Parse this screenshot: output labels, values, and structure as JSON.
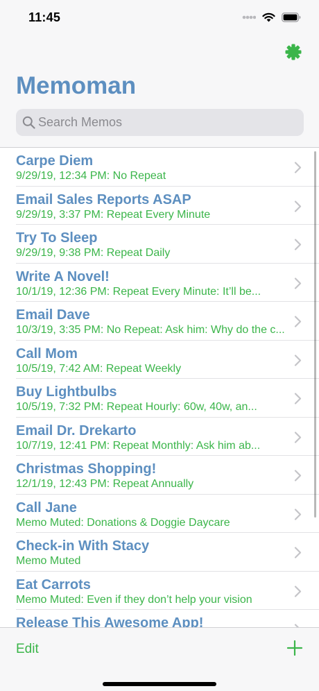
{
  "status_bar": {
    "time": "11:45"
  },
  "header": {
    "title": "Memoman"
  },
  "search": {
    "placeholder": "Search Memos",
    "value": ""
  },
  "colors": {
    "title_blue": "#5d8fc0",
    "accent_green": "#3bb54a"
  },
  "icons": {
    "settings": "gear-icon",
    "search": "search-icon",
    "row_disclosure": "chevron-right-icon",
    "add": "plus-icon"
  },
  "memos": [
    {
      "title": "Carpe Diem",
      "subtitle": "9/29/19, 12:34 PM: No Repeat"
    },
    {
      "title": "Email Sales Reports ASAP",
      "subtitle": "9/29/19, 3:37 PM: Repeat Every Minute"
    },
    {
      "title": "Try To Sleep",
      "subtitle": "9/29/19, 9:38 PM: Repeat Daily"
    },
    {
      "title": "Write A Novel!",
      "subtitle": "10/1/19, 12:36 PM: Repeat Every Minute: It’ll be..."
    },
    {
      "title": "Email Dave",
      "subtitle": "10/3/19, 3:35 PM: No Repeat: Ask him: Why do the c..."
    },
    {
      "title": "Call Mom",
      "subtitle": "10/5/19, 7:42 AM: Repeat Weekly"
    },
    {
      "title": "Buy Lightbulbs",
      "subtitle": "10/5/19, 7:32 PM: Repeat Hourly: 60w, 40w, an..."
    },
    {
      "title": "Email Dr. Drekarto",
      "subtitle": "10/7/19, 12:41 PM: Repeat Monthly: Ask him ab..."
    },
    {
      "title": "Christmas Shopping!",
      "subtitle": "12/1/19, 12:43 PM: Repeat Annually"
    },
    {
      "title": "Call Jane",
      "subtitle": "Memo Muted: Donations & Doggie Daycare"
    },
    {
      "title": "Check-in With Stacy",
      "subtitle": "Memo Muted"
    },
    {
      "title": "Eat Carrots",
      "subtitle": "Memo Muted: Even if they don’t help your vision"
    },
    {
      "title": "Release This Awesome App!",
      "subtitle": ""
    }
  ],
  "toolbar": {
    "edit_label": "Edit"
  }
}
